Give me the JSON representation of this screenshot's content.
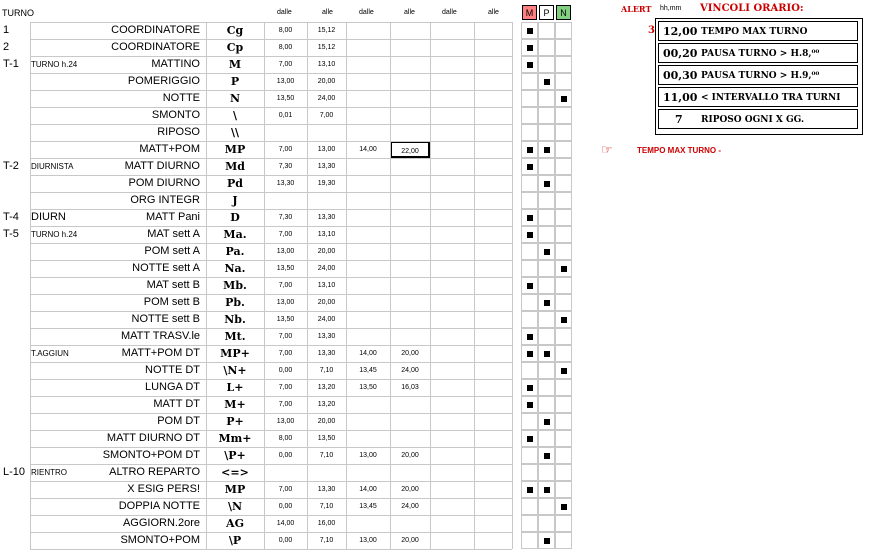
{
  "header": {
    "turno": "TURNO",
    "cols": [
      "dalle",
      "alle",
      "dalle",
      "alle",
      "dalle",
      "alle"
    ],
    "mpn": [
      "M",
      "P",
      "N"
    ],
    "mpn_colors": [
      "#ff8080",
      "#ffffff",
      "#80d080"
    ]
  },
  "rows": [
    {
      "code": "1",
      "group": "",
      "desc": "COORDINATORE",
      "sym": "Cg",
      "t": [
        "8,00",
        "15,12",
        "",
        "",
        "",
        ""
      ],
      "m": true,
      "p": false,
      "n": false
    },
    {
      "code": "2",
      "group": "",
      "desc": "COORDINATORE",
      "sym": "Cp",
      "t": [
        "8,00",
        "15,12",
        "",
        "",
        "",
        ""
      ],
      "m": true,
      "p": false,
      "n": false
    },
    {
      "code": "T-1",
      "group": "TURNO h.24",
      "desc": "MATTINO",
      "sym": "M",
      "t": [
        "7,00",
        "13,10",
        "",
        "",
        "",
        ""
      ],
      "m": true,
      "p": false,
      "n": false
    },
    {
      "code": "",
      "group": "",
      "desc": "POMERIGGIO",
      "sym": "P",
      "t": [
        "13,00",
        "20,00",
        "",
        "",
        "",
        ""
      ],
      "m": false,
      "p": true,
      "n": false
    },
    {
      "code": "",
      "group": "",
      "desc": "NOTTE",
      "sym": "N",
      "t": [
        "13,50",
        "24,00",
        "",
        "",
        "",
        ""
      ],
      "m": false,
      "p": false,
      "n": true
    },
    {
      "code": "",
      "group": "",
      "desc": "SMONTO",
      "sym": "\\",
      "t": [
        "0,01",
        "7,00",
        "",
        "",
        "",
        ""
      ],
      "m": false,
      "p": false,
      "n": false
    },
    {
      "code": "",
      "group": "",
      "desc": "RIPOSO",
      "sym": "\\\\",
      "t": [
        "",
        "",
        "",
        "",
        "",
        ""
      ],
      "m": false,
      "p": false,
      "n": false
    },
    {
      "code": "",
      "group": "",
      "desc": "MATT+POM",
      "sym": "MP",
      "t": [
        "7,00",
        "13,00",
        "14,00",
        "22,00",
        "",
        ""
      ],
      "m": true,
      "p": true,
      "n": false,
      "hl": true
    },
    {
      "code": "T-2",
      "group": "DIURNISTA",
      "desc": "MATT DIURNO",
      "sym": "Md",
      "t": [
        "7,30",
        "13,30",
        "",
        "",
        "",
        ""
      ],
      "m": true,
      "p": false,
      "n": false
    },
    {
      "code": "",
      "group": "",
      "desc": "POM DIURNO",
      "sym": "Pd",
      "t": [
        "13,30",
        "19,30",
        "",
        "",
        "",
        ""
      ],
      "m": false,
      "p": true,
      "n": false
    },
    {
      "code": "",
      "group": "",
      "desc": "ORG INTEGR",
      "sym": "J",
      "t": [
        "",
        "",
        "",
        "",
        "",
        ""
      ],
      "m": false,
      "p": false,
      "n": false
    },
    {
      "code": "T-4",
      "group": "DIURN",
      "big": true,
      "desc": "MATT Pani",
      "sym": "D",
      "t": [
        "7,30",
        "13,30",
        "",
        "",
        "",
        ""
      ],
      "m": true,
      "p": false,
      "n": false
    },
    {
      "code": "T-5",
      "group": "TURNO h.24",
      "desc": "MAT sett A",
      "sym": "Ma.",
      "t": [
        "7,00",
        "13,10",
        "",
        "",
        "",
        ""
      ],
      "m": true,
      "p": false,
      "n": false
    },
    {
      "code": "",
      "group": "",
      "desc": "POM sett A",
      "sym": "Pa.",
      "t": [
        "13,00",
        "20,00",
        "",
        "",
        "",
        ""
      ],
      "m": false,
      "p": true,
      "n": false
    },
    {
      "code": "",
      "group": "",
      "desc": "NOTTE sett A",
      "sym": "Na.",
      "t": [
        "13,50",
        "24,00",
        "",
        "",
        "",
        ""
      ],
      "m": false,
      "p": false,
      "n": true
    },
    {
      "code": "",
      "group": "",
      "desc": "MAT sett B",
      "sym": "Mb.",
      "t": [
        "7,00",
        "13,10",
        "",
        "",
        "",
        ""
      ],
      "m": true,
      "p": false,
      "n": false
    },
    {
      "code": "",
      "group": "",
      "desc": "POM sett B",
      "sym": "Pb.",
      "t": [
        "13,00",
        "20,00",
        "",
        "",
        "",
        ""
      ],
      "m": false,
      "p": true,
      "n": false
    },
    {
      "code": "",
      "group": "",
      "desc": "NOTTE sett B",
      "sym": "Nb.",
      "t": [
        "13,50",
        "24,00",
        "",
        "",
        "",
        ""
      ],
      "m": false,
      "p": false,
      "n": true
    },
    {
      "code": "",
      "group": "",
      "desc": "MATT  TRASV.le",
      "sym": "Mt.",
      "t": [
        "7,00",
        "13,30",
        "",
        "",
        "",
        ""
      ],
      "m": true,
      "p": false,
      "n": false
    },
    {
      "code": "",
      "group": "T.AGGIUN",
      "desc": "MATT+POM DT",
      "sym": "MP+",
      "t": [
        "7,00",
        "13,30",
        "14,00",
        "20,00",
        "",
        ""
      ],
      "m": true,
      "p": true,
      "n": false
    },
    {
      "code": "",
      "group": "",
      "desc": "NOTTE DT",
      "sym": "\\N+",
      "t": [
        "0,00",
        "7,10",
        "13,45",
        "24,00",
        "",
        ""
      ],
      "m": false,
      "p": false,
      "n": true
    },
    {
      "code": "",
      "group": "",
      "desc": "LUNGA DT",
      "sym": "L+",
      "t": [
        "7,00",
        "13,20",
        "13,50",
        "16,03",
        "",
        ""
      ],
      "m": true,
      "p": false,
      "n": false
    },
    {
      "code": "",
      "group": "",
      "desc": "MATT DT",
      "sym": "M+",
      "t": [
        "7,00",
        "13,20",
        "",
        "",
        "",
        ""
      ],
      "m": true,
      "p": false,
      "n": false
    },
    {
      "code": "",
      "group": "",
      "desc": "POM DT",
      "sym": "P+",
      "t": [
        "13,00",
        "20,00",
        "",
        "",
        "",
        ""
      ],
      "m": false,
      "p": true,
      "n": false
    },
    {
      "code": "",
      "group": "",
      "desc": "MATT DIURNO DT",
      "sym": "Mm+",
      "t": [
        "8,00",
        "13,50",
        "",
        "",
        "",
        ""
      ],
      "m": true,
      "p": false,
      "n": false
    },
    {
      "code": "",
      "group": "",
      "desc": "SMONTO+POM DT",
      "sym": "\\P+",
      "t": [
        "0,00",
        "7,10",
        "13,00",
        "20,00",
        "",
        ""
      ],
      "m": false,
      "p": true,
      "n": false
    },
    {
      "code": "L-10",
      "group": "RIENTRO",
      "desc": "ALTRO REPARTO",
      "sym": "<=>",
      "t": [
        "",
        "",
        "",
        "",
        "",
        ""
      ],
      "m": false,
      "p": false,
      "n": false
    },
    {
      "code": "",
      "group": "",
      "desc": "X ESIG PERS!",
      "sym": "MP",
      "t": [
        "7,00",
        "13,30",
        "14,00",
        "20,00",
        "",
        ""
      ],
      "m": true,
      "p": true,
      "n": false
    },
    {
      "code": "",
      "group": "",
      "desc": "DOPPIA NOTTE",
      "sym": "\\N",
      "t": [
        "0,00",
        "7,10",
        "13,45",
        "24,00",
        "",
        ""
      ],
      "m": false,
      "p": false,
      "n": true
    },
    {
      "code": "",
      "group": "",
      "desc": "AGGIORN.2ore",
      "sym": "AG",
      "t": [
        "14,00",
        "16,00",
        "",
        "",
        "",
        ""
      ],
      "m": false,
      "p": false,
      "n": false
    },
    {
      "code": "",
      "group": "",
      "desc": "SMONTO+POM",
      "sym": "\\P",
      "t": [
        "0,00",
        "7,10",
        "13,00",
        "20,00",
        "",
        ""
      ],
      "m": false,
      "p": true,
      "n": false
    }
  ],
  "panel": {
    "alert": "ALERT",
    "hhmm": "hh,mm",
    "title": "VINCOLI ORARIO:",
    "three": "3",
    "rows": [
      {
        "val": "12,00",
        "text": "TEMPO MAX TURNO"
      },
      {
        "val": "00,20",
        "text": "PAUSA TURNO > H.8,⁰⁰"
      },
      {
        "val": "00,30",
        "text": "PAUSA TURNO > H.9,⁰⁰"
      },
      {
        "val": "11,00",
        "text": "< INTERVALLO TRA TURNI"
      },
      {
        "val": "7",
        "text": "RIPOSO OGNI X GG."
      }
    ]
  },
  "warning": {
    "icon": "hand-pointing-icon",
    "text": "TEMPO MAX TURNO -"
  }
}
